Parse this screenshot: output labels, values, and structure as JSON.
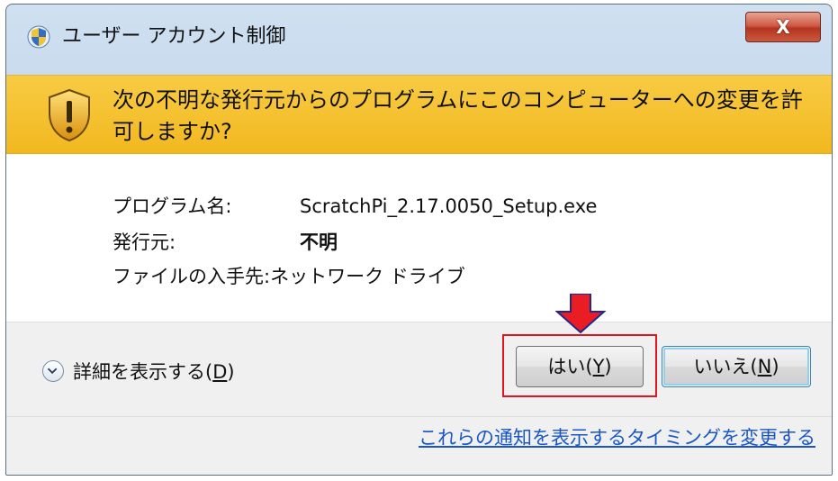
{
  "window": {
    "title": "ユーザー アカウント制御",
    "close_label": "X"
  },
  "banner": {
    "message": "次の不明な発行元からのプログラムにこのコンピューターへの変更を許可しますか?"
  },
  "info": {
    "program_label": "プログラム名:",
    "program_value": "ScratchPi_2.17.0050_Setup.exe",
    "publisher_label": "発行元:",
    "publisher_value": "不明",
    "source_label": "ファイルの入手先:",
    "source_value": "ネットワーク ドライブ"
  },
  "footer": {
    "details_text": "詳細を表示する(",
    "details_key": "D",
    "details_end": ")",
    "yes_text": "はい(",
    "yes_key": "Y",
    "yes_end": ")",
    "no_text": "いいえ(",
    "no_key": "N",
    "no_end": ")",
    "notification_link": "これらの通知を表示するタイミングを変更する"
  },
  "colors": {
    "banner": "#f4bd2a",
    "highlight": "#e0161e",
    "arrow": "#ea1c24",
    "link": "#1a57c5"
  }
}
